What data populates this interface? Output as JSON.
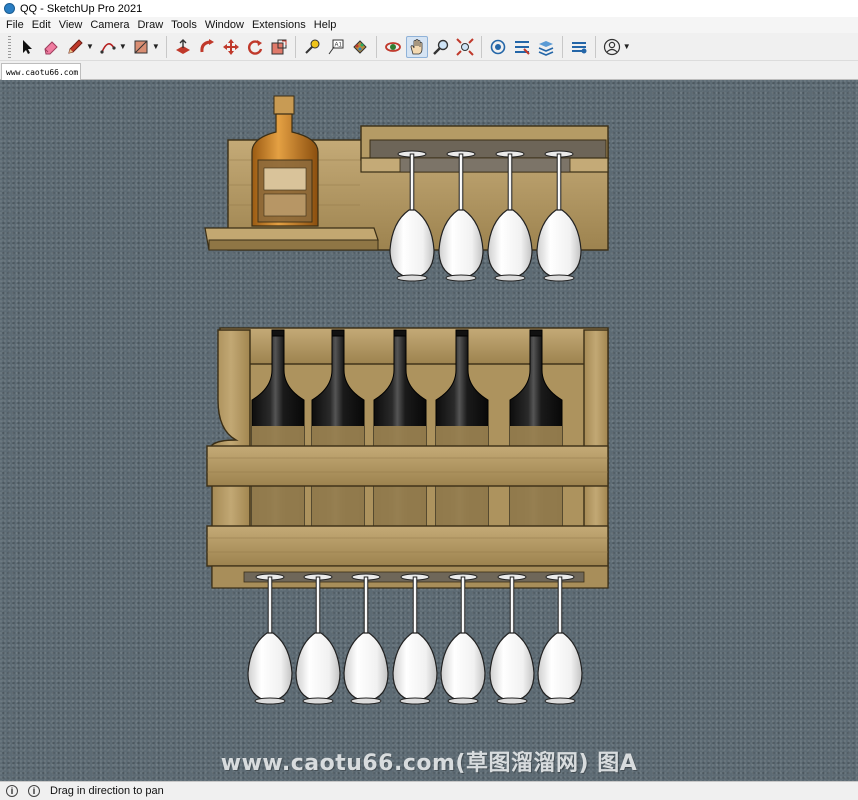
{
  "window": {
    "title": "QQ - SketchUp Pro 2021",
    "icon": "sketchup-logo-icon"
  },
  "menu": [
    "File",
    "Edit",
    "View",
    "Camera",
    "Draw",
    "Tools",
    "Window",
    "Extensions",
    "Help"
  ],
  "toolbar": {
    "tools": [
      "select-icon",
      "eraser-icon",
      "pencil-icon",
      "arc-icon",
      "rectangle-icon",
      "push-pull-icon",
      "follow-me-icon",
      "move-icon",
      "rotate-icon",
      "scale-icon",
      "tape-measure-icon",
      "text-icon",
      "paint-bucket-icon",
      "orbit-icon",
      "pan-icon",
      "zoom-icon",
      "zoom-extents-icon",
      "warehouse-icon",
      "extension-warehouse-icon",
      "layout-icon",
      "trimble-connect-icon",
      "account-icon"
    ],
    "active_tool": "pan-icon"
  },
  "scene_tab": {
    "label": "www.caotu66.com"
  },
  "viewport": {
    "watermark": "www.caotu66.com(草图溜溜网) 图A",
    "background_color": "#5d6b74",
    "objects": {
      "upper_shelf": {
        "bottle_count": 1,
        "glass_count": 4
      },
      "lower_rack": {
        "bottle_count": 5,
        "glass_count": 7
      }
    }
  },
  "status": {
    "message": "Drag in direction to pan"
  },
  "colors": {
    "wood": "#b39a63",
    "wood_dark": "#8b7446",
    "glass": "#f3f3f3",
    "bottle": "#1e1e1e",
    "active_tool_bg": "#d6e4f3"
  }
}
